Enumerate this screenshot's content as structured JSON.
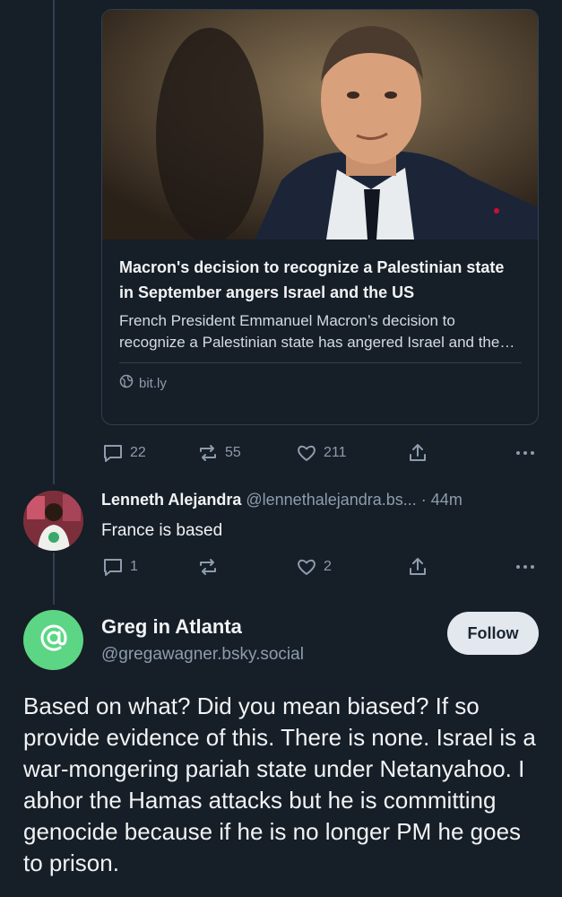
{
  "card": {
    "title": "Macron's decision to recognize a Palestinian state in September angers Israel and the US",
    "description": "French President Emmanuel Macron’s decision to recognize a Palestinian state has angered Israel and the US",
    "domain": "bit.ly"
  },
  "parent_actions": {
    "replies": "22",
    "reposts": "55",
    "likes": "211"
  },
  "reply": {
    "name": "Lenneth Alejandra",
    "handle": "@lennethalejandra.bs...",
    "time": "· 44m",
    "text": "France is based",
    "replies": "1",
    "likes": "2"
  },
  "focused": {
    "name": "Greg in Atlanta",
    "handle": "@gregawagner.bsky.social",
    "follow_label": "Follow",
    "avatar_color": "#5cd685",
    "text": "Based on what? Did you mean biased? If so provide evidence of this. There is none. Israel is a war-mongering pariah state under Netanyahoo. I abhor the Hamas attacks but he is committing genocide because if he is no longer PM he goes to prison."
  }
}
